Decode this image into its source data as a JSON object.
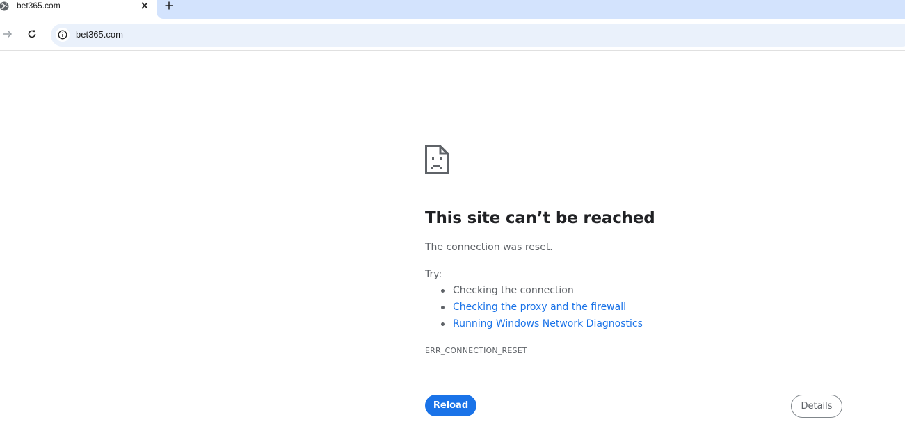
{
  "tab": {
    "title": "bet365.com",
    "favicon": "globe-icon",
    "close_icon": "close-icon",
    "new_tab_icon": "plus-icon"
  },
  "toolbar": {
    "forward_icon": "arrow-right-icon",
    "reload_icon": "reload-icon",
    "site_info_icon": "info-icon",
    "url": "bet365.com"
  },
  "error": {
    "icon": "sad-document-icon",
    "title": "This site can’t be reached",
    "description": "The connection was reset.",
    "try_label": "Try:",
    "suggestions": [
      {
        "label": "Checking the connection",
        "is_link": false
      },
      {
        "label": "Checking the proxy and the firewall",
        "is_link": true
      },
      {
        "label": "Running Windows Network Diagnostics",
        "is_link": true
      }
    ],
    "code": "ERR_CONNECTION_RESET",
    "reload_label": "Reload",
    "details_label": "Details"
  },
  "colors": {
    "accent": "#1a73e8",
    "tabstrip": "#d3e3fd",
    "omnibox": "#eaf1fb",
    "secondary_text": "#5f6368"
  }
}
